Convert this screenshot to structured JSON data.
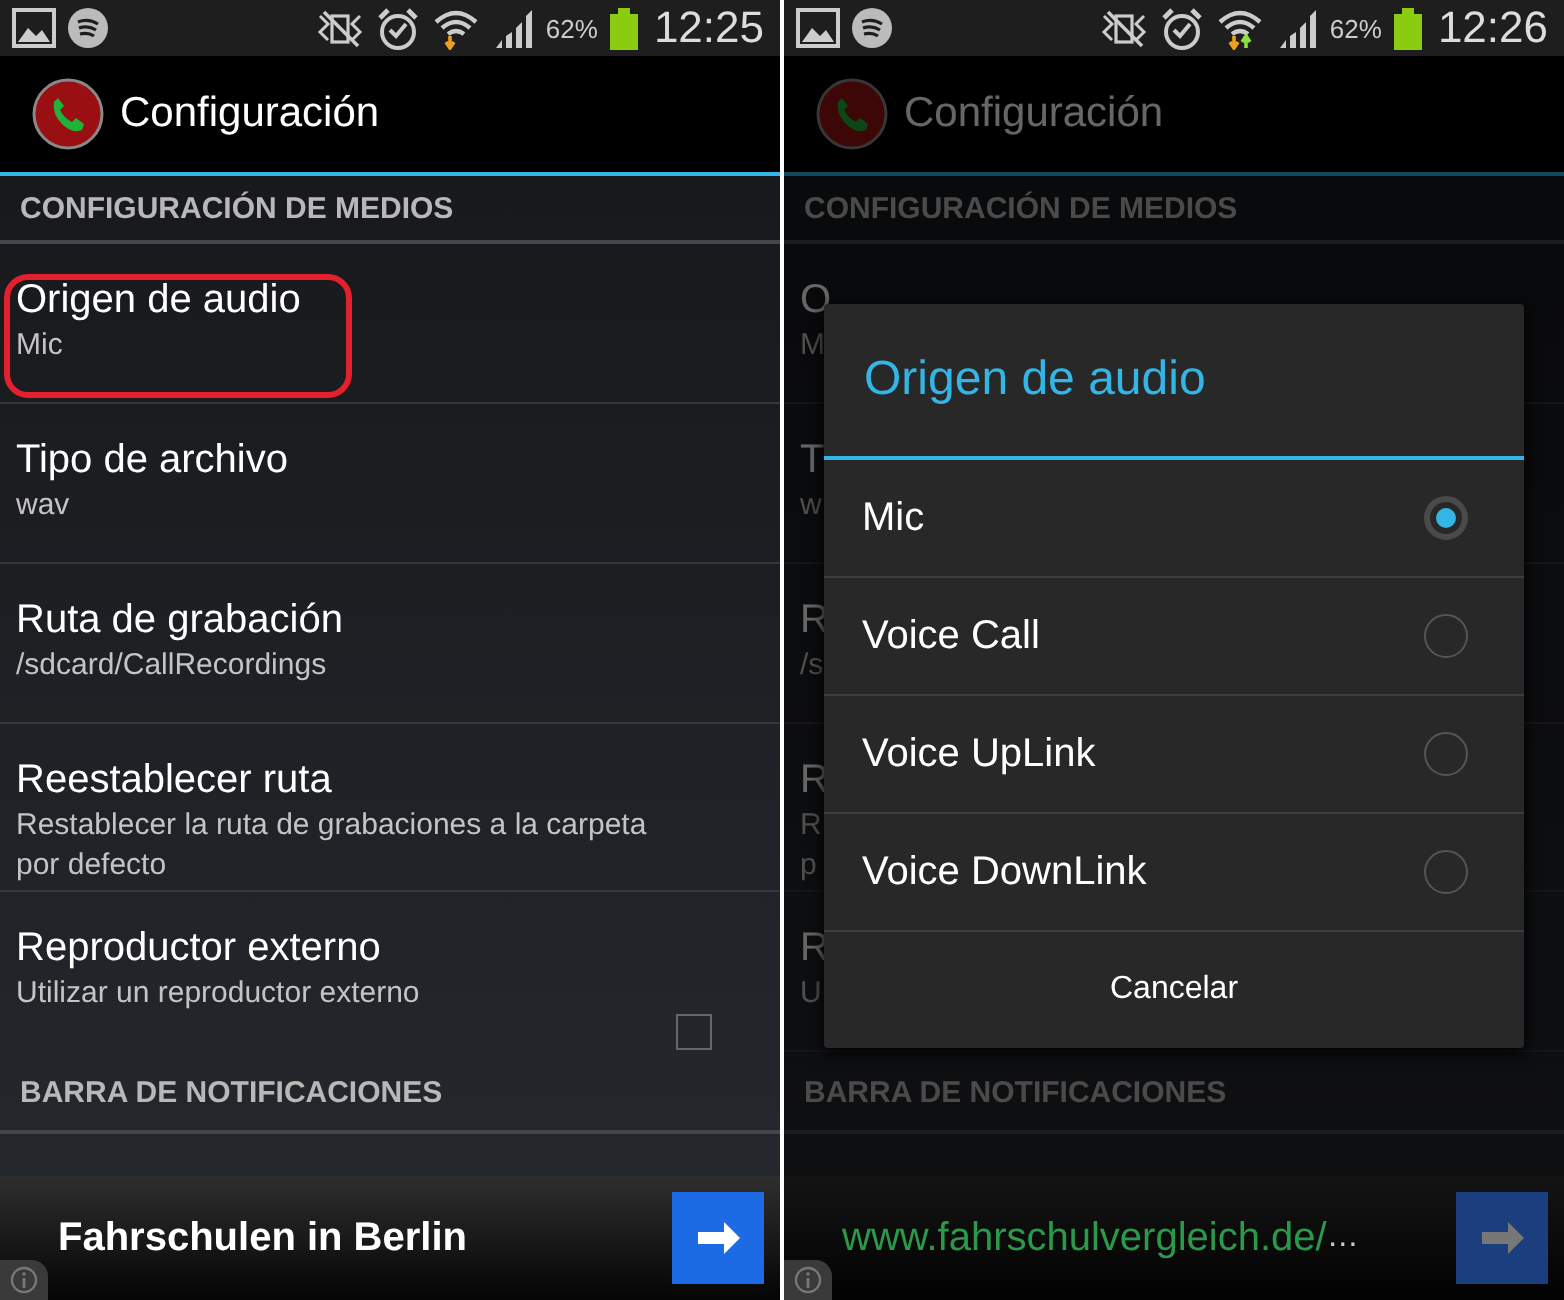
{
  "screens": [
    {
      "status_bar": {
        "battery": "62%",
        "time": "12:25",
        "wifi_upload": false
      },
      "action_bar": {
        "title": "Configuración"
      },
      "dimmed": false,
      "sections": [
        {
          "header": "CONFIGURACIÓN DE MEDIOS",
          "items": [
            {
              "kind": "text",
              "title": "Origen de audio",
              "summary": [
                "Mic"
              ],
              "highlighted": true
            },
            {
              "kind": "text",
              "title": "Tipo de archivo",
              "summary": [
                "wav"
              ],
              "highlighted": false
            },
            {
              "kind": "text",
              "title": "Ruta de grabación",
              "summary": [
                "/sdcard/CallRecordings"
              ],
              "highlighted": false
            },
            {
              "kind": "text",
              "title": "Reestablecer ruta",
              "summary": [
                "Restablecer la ruta de grabaciones a la carpeta",
                "por defecto"
              ],
              "highlighted": false
            },
            {
              "kind": "checkbox",
              "title": "Reproductor externo",
              "summary": [
                "Utilizar un reproductor externo"
              ],
              "checked": false,
              "highlighted": false
            }
          ]
        },
        {
          "header": "BARRA DE NOTIFICACIONES"
        }
      ],
      "ad": {
        "text": "Fahrschulen in Berlin"
      }
    },
    {
      "status_bar": {
        "battery": "62%",
        "time": "12:26",
        "wifi_upload": true
      },
      "action_bar": {
        "title": "Configuración"
      },
      "dimmed": true,
      "sections": [
        {
          "header": "CONFIGURACIÓN DE MEDIOS",
          "items": [
            {
              "kind": "text",
              "title": "O",
              "summary": [
                "M"
              ],
              "highlighted": false
            },
            {
              "kind": "text",
              "title": "T",
              "summary": [
                "w"
              ],
              "highlighted": false
            },
            {
              "kind": "text",
              "title": "R",
              "summary": [
                "/s"
              ],
              "highlighted": false
            },
            {
              "kind": "text",
              "title": "R",
              "summary": [
                "R",
                "p"
              ],
              "highlighted": false
            },
            {
              "kind": "text",
              "title": "R",
              "summary": [
                "U"
              ],
              "highlighted": false
            }
          ]
        },
        {
          "header": "BARRA DE NOTIFICACIONES"
        }
      ],
      "ad": {
        "url": "www.fahrschulvergleich.de/",
        "ellipsis": "…"
      },
      "dialog": {
        "title": "Origen de audio",
        "options": [
          {
            "label": "Mic",
            "selected": true
          },
          {
            "label": "Voice Call",
            "selected": false
          },
          {
            "label": "Voice UpLink",
            "selected": false
          },
          {
            "label": "Voice DownLink",
            "selected": false
          }
        ],
        "cancel": "Cancelar"
      }
    }
  ]
}
